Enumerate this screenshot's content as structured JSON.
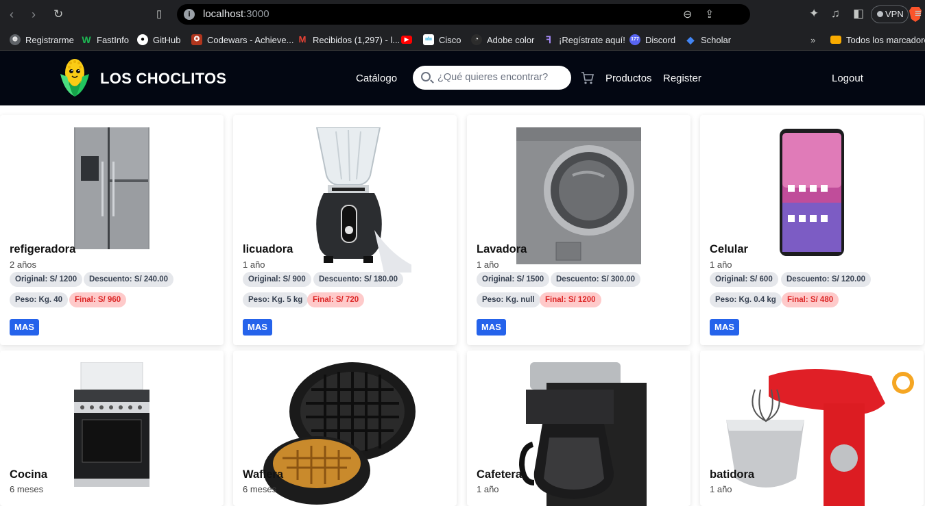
{
  "browser": {
    "url_host": "localhost",
    "url_port": ":3000",
    "vpn_label": "VPN"
  },
  "bookmarks": [
    {
      "label": "Registrarme",
      "icon": "globe-icon",
      "color": "#e8eaed"
    },
    {
      "label": "FastInfo",
      "icon": "w-icon",
      "color": "#1db954"
    },
    {
      "label": "GitHub",
      "icon": "github-icon",
      "color": "#ffffff"
    },
    {
      "label": "Codewars - Achieve...",
      "icon": "codewars-icon",
      "color": "#b1361e"
    },
    {
      "label": "Recibidos (1,297) - l...",
      "icon": "gmail-icon",
      "color": "#ea4335"
    },
    {
      "label": "",
      "icon": "youtube-icon",
      "color": "#ff0000"
    },
    {
      "label": "Cisco",
      "icon": "cisco-icon",
      "color": "#049fd9"
    },
    {
      "label": "Adobe color",
      "icon": "adobe-icon",
      "color": "#2c2c2c"
    },
    {
      "label": "¡Regístrate aquí!",
      "icon": "register-icon",
      "color": "#7c3aed"
    },
    {
      "label": "Discord",
      "icon": "discord-icon",
      "color": "#5865f2"
    },
    {
      "label": "Scholar",
      "icon": "scholar-icon",
      "color": "#4285f4"
    },
    {
      "label": "Todos los marcadores",
      "icon": "folder-icon",
      "color": "#f9ab00"
    }
  ],
  "header": {
    "brand": "LOS CHOCLITOS",
    "catalog": "Catálogo",
    "search_placeholder": "¿Qué quieres encontrar?",
    "products": "Productos",
    "register": "Register",
    "logout": "Logout"
  },
  "products": [
    {
      "name": "refigeradora",
      "age": "2 años",
      "original": "Original: S/ 1200",
      "discount": "Descuento: S/ 240.00",
      "weight": "Peso: Kg. 40",
      "final": "Final: S/ 960",
      "button": "MAS",
      "image": "refrigerator"
    },
    {
      "name": "licuadora",
      "age": "1 año",
      "original": "Original: S/ 900",
      "discount": "Descuento: S/ 180.00",
      "weight": "Peso: Kg. 5 kg",
      "final": "Final: S/ 720",
      "button": "MAS",
      "image": "blender"
    },
    {
      "name": "Lavadora",
      "age": "1 año",
      "original": "Original: S/ 1500",
      "discount": "Descuento: S/ 300.00",
      "weight": "Peso: Kg. null",
      "final": "Final: S/ 1200",
      "button": "MAS",
      "image": "washer"
    },
    {
      "name": "Celular",
      "age": "1 año",
      "original": "Original: S/ 600",
      "discount": "Descuento: S/ 120.00",
      "weight": "Peso: Kg. 0.4 kg",
      "final": "Final: S/ 480",
      "button": "MAS",
      "image": "phone"
    },
    {
      "name": "Cocina",
      "age": "6 meses",
      "image": "stove"
    },
    {
      "name": "Waflera",
      "age": "6 meses",
      "image": "waffle-maker"
    },
    {
      "name": "Cafetera",
      "age": "1 año",
      "image": "coffee-maker"
    },
    {
      "name": "batidora",
      "age": "1 año",
      "image": "stand-mixer"
    }
  ]
}
